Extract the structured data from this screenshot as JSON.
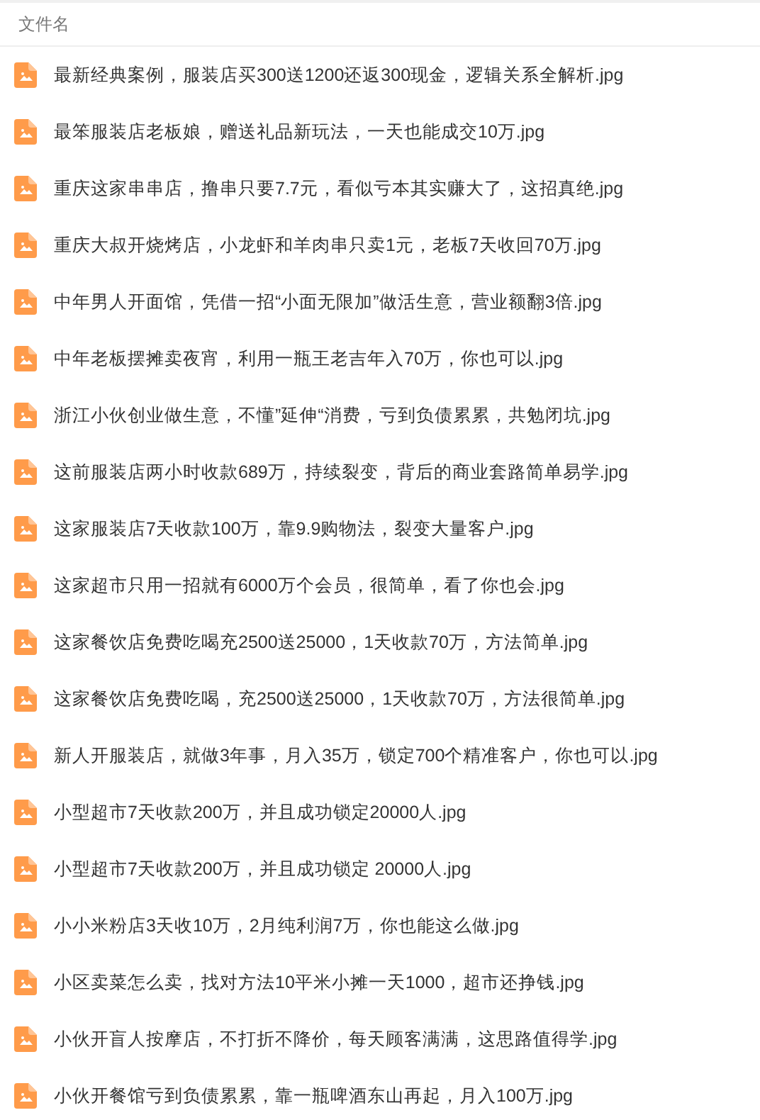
{
  "table": {
    "header": "文件名",
    "files": [
      {
        "name": "最新经典案例，服装店买300送1200还返300现金，逻辑关系全解析.jpg"
      },
      {
        "name": "最笨服装店老板娘，赠送礼品新玩法，一天也能成交10万.jpg"
      },
      {
        "name": "重庆这家串串店，撸串只要7.7元，看似亏本其实赚大了，这招真绝.jpg"
      },
      {
        "name": "重庆大叔开烧烤店，小龙虾和羊肉串只卖1元，老板7天收回70万.jpg"
      },
      {
        "name": "中年男人开面馆，凭借一招“小面无限加”做活生意，营业额翻3倍.jpg"
      },
      {
        "name": "中年老板摆摊卖夜宵，利用一瓶王老吉年入70万，你也可以.jpg"
      },
      {
        "name": "浙江小伙创业做生意，不懂”延伸“消费，亏到负债累累，共勉闭坑.jpg"
      },
      {
        "name": "这前服装店两小时收款689万，持续裂变，背后的商业套路简单易学.jpg"
      },
      {
        "name": "这家服装店7天收款100万，靠9.9购物法，裂变大量客户.jpg"
      },
      {
        "name": "这家超市只用一招就有6000万个会员，很简单，看了你也会.jpg"
      },
      {
        "name": "这家餐饮店免费吃喝充2500送25000，1天收款70万，方法简单.jpg"
      },
      {
        "name": "这家餐饮店免费吃喝，充2500送25000，1天收款70万，方法很简单.jpg"
      },
      {
        "name": "新人开服装店，就做3年事，月入35万，锁定700个精准客户，你也可以.jpg"
      },
      {
        "name": "小型超市7天收款200万，并且成功锁定20000人.jpg"
      },
      {
        "name": "小型超市7天收款200万，并且成功锁定 20000人.jpg"
      },
      {
        "name": "小小米粉店3天收10万，2月纯利润7万，你也能这么做.jpg"
      },
      {
        "name": "小区卖菜怎么卖，找对方法10平米小摊一天1000，超市还挣钱.jpg"
      },
      {
        "name": "小伙开盲人按摩店，不打折不降价，每天顾客满满，这思路值得学.jpg"
      },
      {
        "name": "小伙开餐馆亏到负债累累，靠一瓶啤酒东山再起，月入100万.jpg"
      }
    ]
  }
}
